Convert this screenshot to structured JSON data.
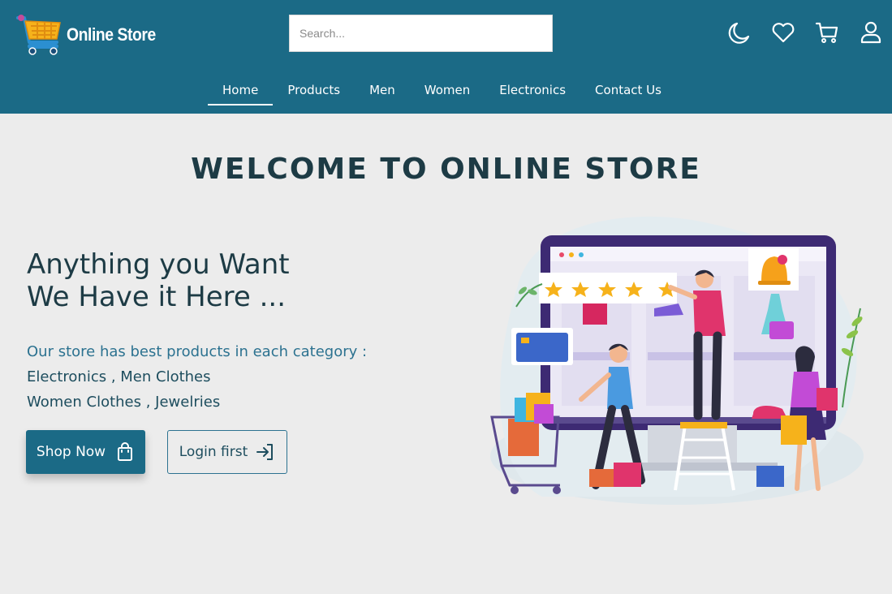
{
  "header": {
    "brand": "Online Store",
    "search_placeholder": "Search...",
    "icons": [
      "moon-icon",
      "heart-icon",
      "cart-icon",
      "user-icon"
    ]
  },
  "nav": {
    "items": [
      "Home",
      "Products",
      "Men",
      "Women",
      "Electronics",
      "Contact Us"
    ],
    "active": "Home"
  },
  "hero": {
    "welcome": "WELCOME TO ONLINE STORE",
    "headline_line1": "Anything you Want",
    "headline_line2": "We Have it Here ...",
    "desc_line1": "Our store has best products in each category :",
    "desc_line2": "Electronics , Men Clothes",
    "desc_line3": "Women Clothes , Jewelries",
    "shop_button": "Shop Now",
    "login_button": "Login first"
  },
  "colors": {
    "header_bg": "#1b6a86",
    "page_bg": "#ececec",
    "title_text": "#1d3b45",
    "accent_text": "#2c7290"
  }
}
